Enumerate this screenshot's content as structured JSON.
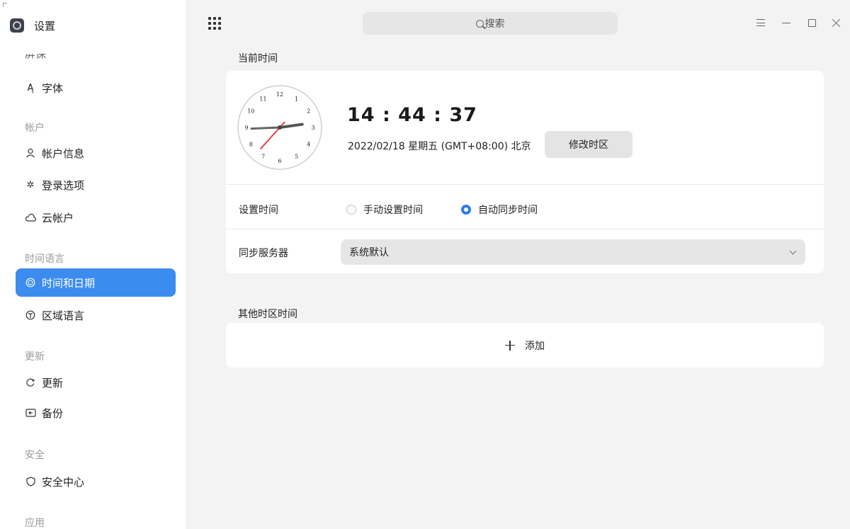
{
  "app": {
    "title": "设置"
  },
  "search": {
    "placeholder": "搜索"
  },
  "sidebar": {
    "partial_item": "屏保",
    "items": [
      {
        "label": "字体",
        "icon": "font-icon",
        "glyph": "A",
        "active": false
      },
      {
        "label": "帐户信息",
        "icon": "user-icon",
        "glyph": "ᴖ",
        "active": false
      },
      {
        "label": "登录选项",
        "icon": "login-options-icon",
        "glyph": "✲",
        "active": false
      },
      {
        "label": "云帐户",
        "icon": "cloud-account-icon",
        "glyph": "◔",
        "active": false
      },
      {
        "label": "时间和日期",
        "icon": "clock-icon",
        "glyph": "◷",
        "active": true
      },
      {
        "label": "区域语言",
        "icon": "region-language-icon",
        "glyph": "⊤",
        "active": false
      },
      {
        "label": "更新",
        "icon": "update-icon",
        "glyph": "↻",
        "active": false
      },
      {
        "label": "备份",
        "icon": "backup-icon",
        "glyph": "⇤",
        "active": false
      },
      {
        "label": "安全中心",
        "icon": "shield-icon",
        "glyph": "⛉",
        "active": false
      }
    ],
    "groups": [
      "帐户",
      "时间语言",
      "更新",
      "安全",
      "应用"
    ]
  },
  "main": {
    "current_time_label": "当前时间",
    "time": "14 : 44 : 37",
    "date_line": "2022/02/18 星期五  (GMT+08:00) 北京",
    "change_timezone_label": "修改时区",
    "set_time_label": "设置时间",
    "manual_option": "手动设置时间",
    "auto_option": "自动同步时间",
    "selected_mode": "auto",
    "sync_server_label": "同步服务器",
    "sync_server_value": "系统默认",
    "other_timezones_label": "其他时区时间",
    "add_label": "添加"
  },
  "clock": {
    "numbers": [
      "12",
      "1",
      "2",
      "3",
      "4",
      "5",
      "6",
      "7",
      "8",
      "9",
      "10",
      "11"
    ],
    "hour": 14,
    "minute": 44,
    "second": 37
  },
  "colors": {
    "accent": "#3c8cf0",
    "radio": "#2b7de9",
    "second_hand": "#e8423f"
  }
}
